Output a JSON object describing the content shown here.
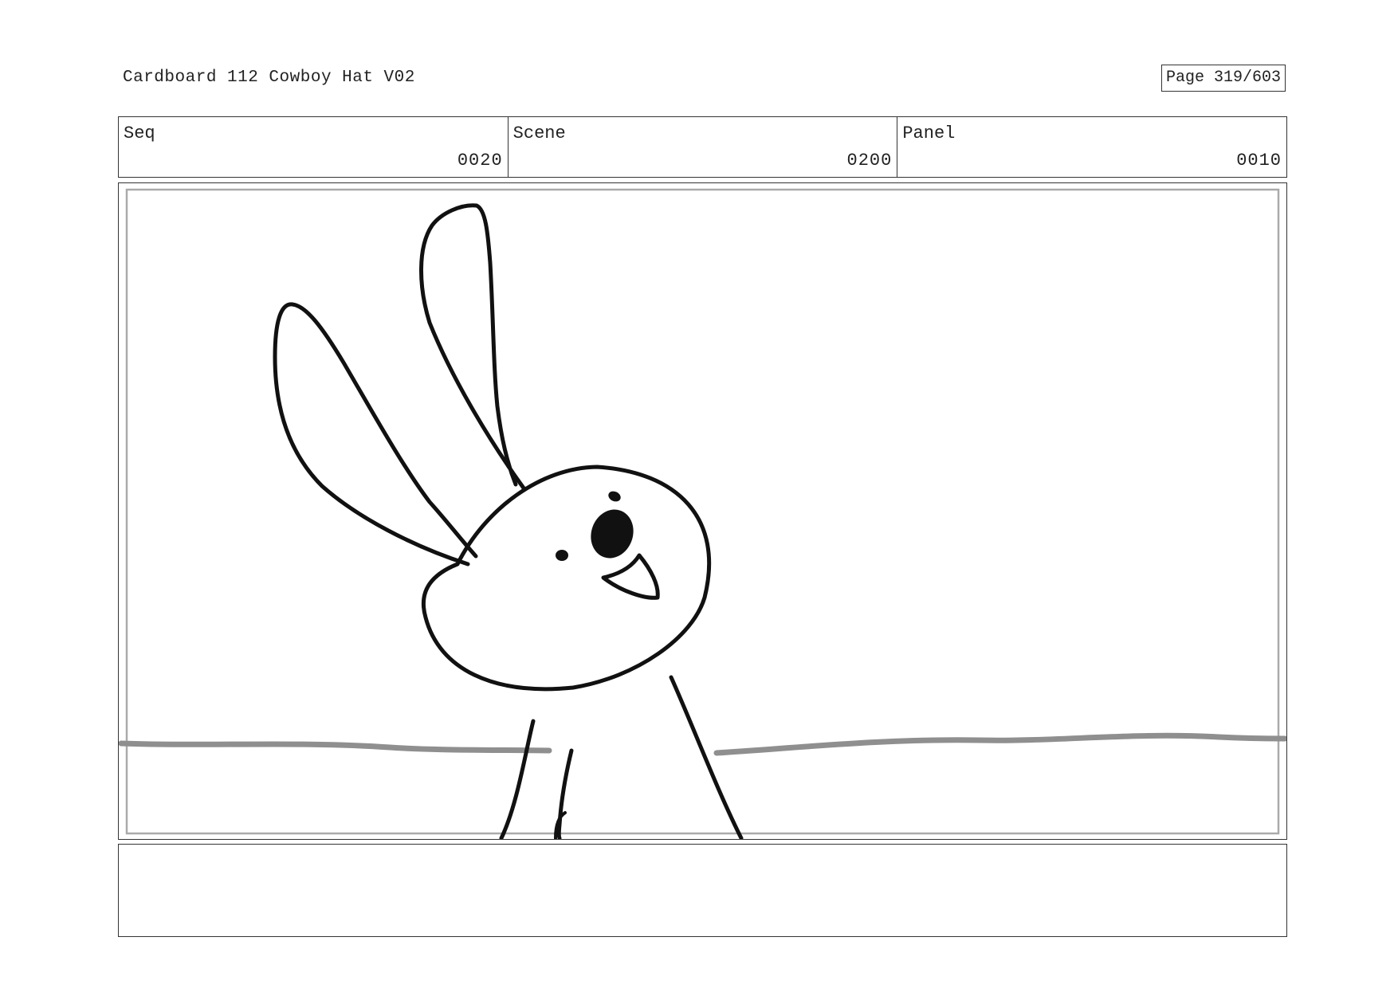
{
  "header": {
    "title": "Cardboard 112 Cowboy Hat V02",
    "page": "Page 319/603"
  },
  "info": {
    "seq_label": "Seq",
    "seq_value": "0020",
    "scene_label": "Scene",
    "scene_value": "0200",
    "panel_label": "Panel",
    "panel_value": "0010"
  },
  "notes": {
    "text": ""
  }
}
